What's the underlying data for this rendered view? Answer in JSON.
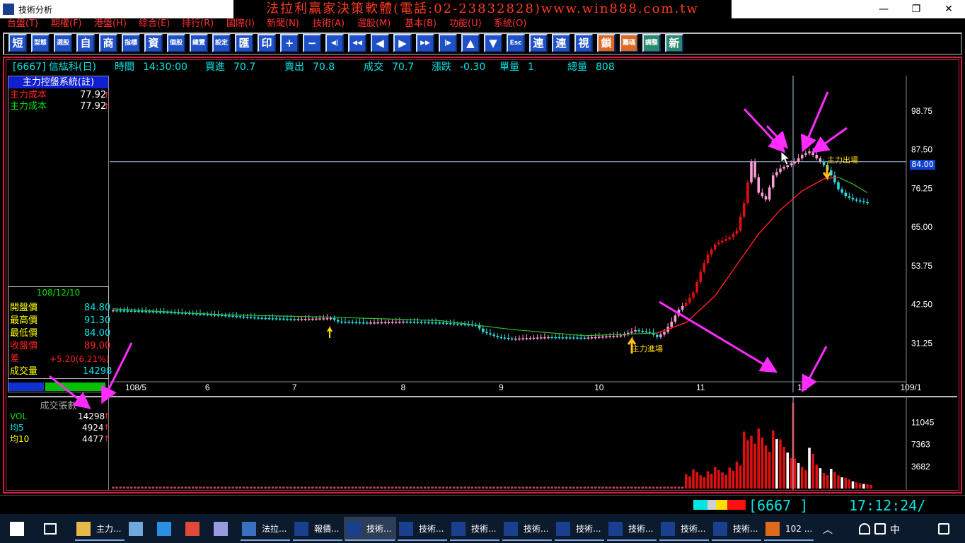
{
  "window": {
    "title": "技術分析",
    "banner": "法拉利贏家決策軟體(電話:02-23832828)www.win888.com.tw",
    "minimize": "—",
    "restore": "❐",
    "close": "✕"
  },
  "menu": [
    "台盤(T)",
    "期權(F)",
    "港盤(H)",
    "綜合(E)",
    "排行(R)",
    "國際(I)",
    "新聞(N)",
    "技術(A)",
    "選股(M)",
    "基本(B)",
    "功能(U)",
    "系統(O)"
  ],
  "toolbar": [
    "短",
    "型態",
    "選股",
    "自",
    "商",
    "指標",
    "資",
    "個股",
    "總覽",
    "設定",
    "匯",
    "印",
    "+",
    "−",
    "◀|",
    "◀◀",
    "◀",
    "▶",
    "▶▶",
    "|▶",
    "▲",
    "▼",
    "Esc",
    "連",
    "連",
    "視",
    "鎖",
    "籌碼",
    "調整",
    "新"
  ],
  "info": {
    "symbol": "[6667] 信紘科(日)",
    "time_label": "時間",
    "time": "14:30:00",
    "buy_label": "買進",
    "buy": "70.7",
    "sell_label": "賣出",
    "sell": "70.8",
    "deal_label": "成交",
    "deal": "70.7",
    "change_label": "漲跌",
    "change": "-0.30",
    "unit_label": "單量",
    "unit": "1",
    "total_label": "總量",
    "total": "808"
  },
  "left_panel": {
    "title": "主力控盤系統(註)",
    "cost_rows": [
      {
        "label": "主力成本",
        "value": "77.92",
        "arrow": "↑"
      },
      {
        "label": "主力成本",
        "value": "77.92",
        "arrow": "↑"
      }
    ],
    "date": "108/12/10",
    "quote": [
      {
        "label": "開盤價",
        "value": "84.80"
      },
      {
        "label": "最高價",
        "value": "91.30"
      },
      {
        "label": "最低價",
        "value": "84.00"
      },
      {
        "label": "收盤價",
        "value": "89.00"
      },
      {
        "label": "差",
        "value": "+5.20(6.21%)"
      },
      {
        "label": "成交量",
        "value": "14298"
      }
    ]
  },
  "volume_panel": {
    "title": "成交張數",
    "rows": [
      {
        "label": "VOL",
        "value": "14298",
        "arrow": "↑"
      },
      {
        "label": "均5",
        "value": "4924",
        "arrow": "↑"
      },
      {
        "label": "均10",
        "value": "4477",
        "arrow": "↑"
      }
    ]
  },
  "annotations": {
    "entry": "主力進場",
    "exit": "主力出場"
  },
  "crosshair_price": "84.00",
  "chart_data": {
    "type": "candlestick",
    "x_labels": [
      "108/5",
      "6",
      "7",
      "8",
      "9",
      "10",
      "11",
      "12",
      "109/1"
    ],
    "price_ticks": [
      "98.75",
      "87.50",
      "76.25",
      "65.00",
      "53.75",
      "42.50",
      "31.25"
    ],
    "price_range": [
      20,
      108
    ],
    "volume_ticks": [
      "11045",
      "7363",
      "3682"
    ],
    "volume_range": [
      0,
      14500
    ],
    "close_path": [
      [
        0,
        40.8
      ],
      [
        10,
        40.5
      ],
      [
        20,
        40
      ],
      [
        28,
        39.5
      ],
      [
        40,
        38.6
      ],
      [
        50,
        38.2
      ],
      [
        60,
        38.5
      ],
      [
        62,
        37.5
      ],
      [
        70,
        37.2
      ],
      [
        80,
        37.5
      ],
      [
        90,
        37.2
      ],
      [
        100,
        36.5
      ],
      [
        102,
        34.5
      ],
      [
        106,
        33
      ],
      [
        110,
        32.5
      ],
      [
        120,
        33
      ],
      [
        130,
        32.8
      ],
      [
        140,
        33.5
      ],
      [
        144,
        35
      ],
      [
        148,
        34.3
      ],
      [
        150,
        33
      ],
      [
        152,
        34.5
      ],
      [
        154,
        37.5
      ],
      [
        156,
        41
      ],
      [
        158,
        43
      ],
      [
        160,
        46
      ],
      [
        162,
        52
      ],
      [
        164,
        57
      ],
      [
        166,
        60
      ],
      [
        168,
        61
      ],
      [
        170,
        62
      ],
      [
        172,
        64
      ],
      [
        174,
        72
      ],
      [
        176,
        84
      ],
      [
        178,
        75
      ],
      [
        180,
        73
      ],
      [
        182,
        80
      ],
      [
        184,
        82
      ],
      [
        186,
        83
      ],
      [
        188,
        84
      ],
      [
        190,
        86
      ],
      [
        192,
        87
      ],
      [
        194,
        85
      ],
      [
        196,
        83
      ],
      [
        198,
        80
      ],
      [
        200,
        76
      ],
      [
        202,
        74
      ],
      [
        204,
        73
      ],
      [
        206,
        72.5
      ],
      [
        208,
        72
      ]
    ],
    "cost_line": [
      [
        0,
        41.2
      ],
      [
        30,
        39.5
      ],
      [
        60,
        38.8
      ],
      [
        90,
        37.8
      ],
      [
        110,
        35.2
      ],
      [
        130,
        33.4
      ],
      [
        150,
        34.2
      ],
      [
        158,
        37.2
      ],
      [
        166,
        45
      ],
      [
        172,
        54
      ],
      [
        178,
        63
      ],
      [
        184,
        70
      ],
      [
        190,
        75.5
      ],
      [
        196,
        79
      ],
      [
        200,
        79.5
      ],
      [
        204,
        77.5
      ],
      [
        208,
        75
      ]
    ],
    "volume": [
      [
        158,
        2400
      ],
      [
        160,
        3200
      ],
      [
        162,
        2200
      ],
      [
        164,
        2900
      ],
      [
        166,
        3600
      ],
      [
        168,
        2700
      ],
      [
        170,
        3500
      ],
      [
        172,
        4500
      ],
      [
        174,
        9500
      ],
      [
        176,
        8800
      ],
      [
        178,
        10000
      ],
      [
        180,
        7200
      ],
      [
        182,
        9700
      ],
      [
        184,
        8200
      ],
      [
        186,
        6000
      ],
      [
        188,
        5000
      ],
      [
        190,
        3600
      ],
      [
        192,
        6800
      ],
      [
        194,
        4000
      ],
      [
        196,
        2600
      ],
      [
        198,
        3300
      ],
      [
        200,
        2200
      ],
      [
        202,
        1800
      ],
      [
        204,
        1200
      ],
      [
        206,
        900
      ],
      [
        208,
        700
      ]
    ]
  }
}
